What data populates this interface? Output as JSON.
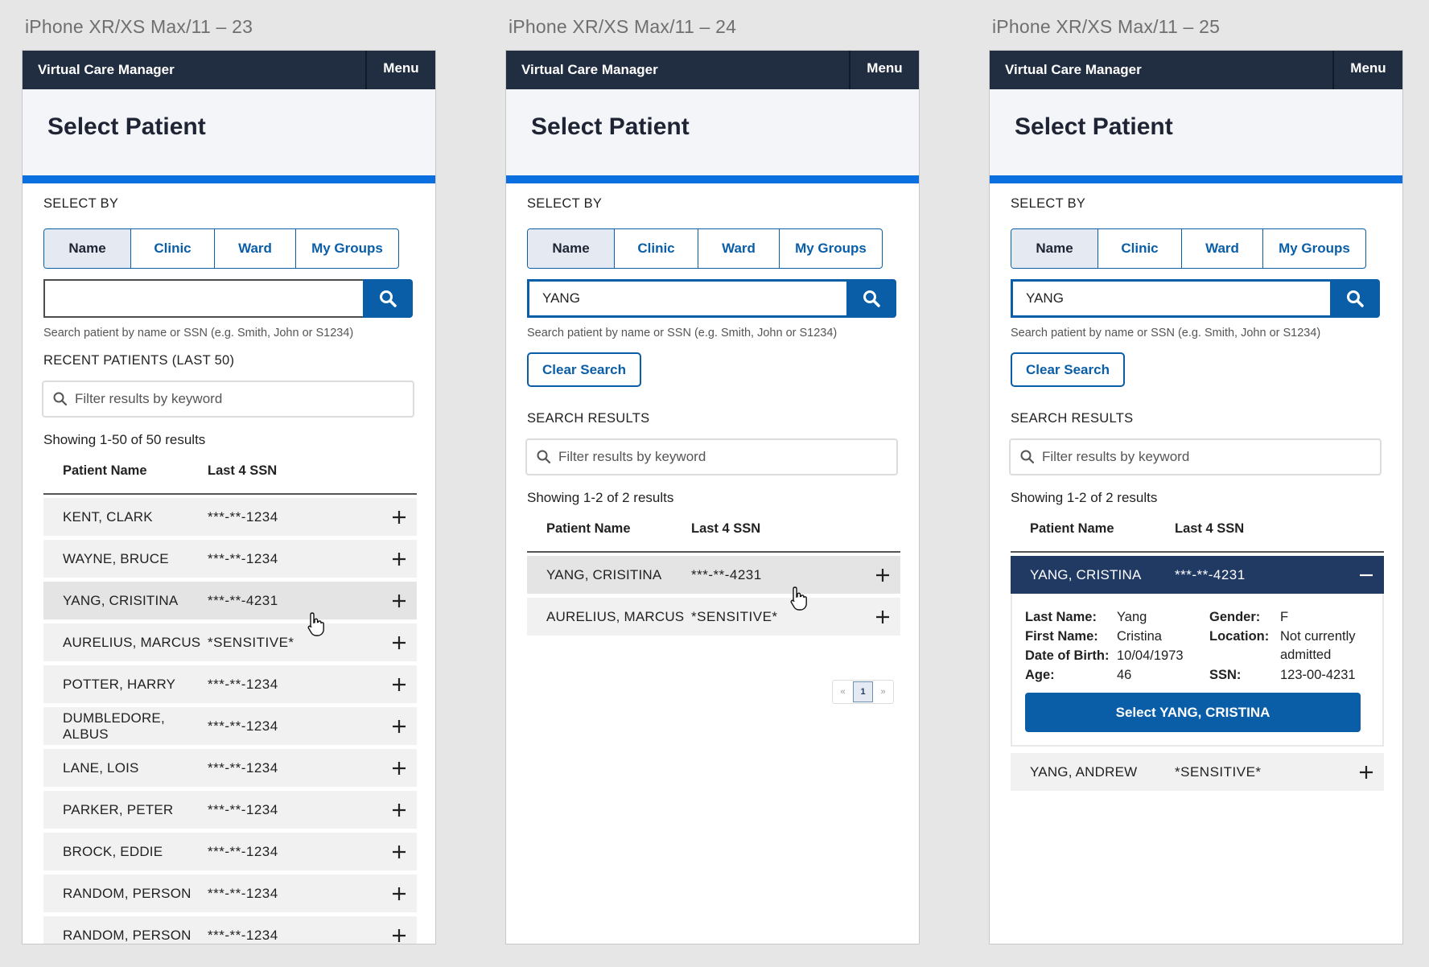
{
  "artboards": [
    {
      "label": "iPhone XR/XS Max/11 – 23"
    },
    {
      "label": "iPhone XR/XS Max/11 – 24"
    },
    {
      "label": "iPhone XR/XS Max/11 – 25"
    }
  ],
  "app": {
    "title": "Virtual Care Manager",
    "menu_label": "Menu"
  },
  "page": {
    "title": "Select Patient"
  },
  "select_by": {
    "label": "SELECT BY",
    "options": [
      "Name",
      "Clinic",
      "Ward",
      "My Groups"
    ],
    "selected": "Name"
  },
  "search": {
    "hint": "Search patient by name or SSN (e.g. Smith, John or S1234)",
    "value_empty": "",
    "value_yang": "YANG",
    "clear_label": "Clear Search"
  },
  "filter": {
    "placeholder": "Filter results by keyword"
  },
  "table": {
    "col_name": "Patient Name",
    "col_ssn": "Last 4 SSN"
  },
  "screen1": {
    "section_label": "RECENT PATIENTS (LAST 50)",
    "showing": "Showing 1-50 of 50 results",
    "rows": [
      {
        "name": "KENT, CLARK",
        "ssn": "***-**-1234"
      },
      {
        "name": "WAYNE, BRUCE",
        "ssn": "***-**-1234"
      },
      {
        "name": "YANG, CRISITINA",
        "ssn": "***-**-4231"
      },
      {
        "name": "AURELIUS, MARCUS",
        "ssn": "*SENSITIVE*"
      },
      {
        "name": "POTTER, HARRY",
        "ssn": "***-**-1234"
      },
      {
        "name": "DUMBLEDORE, ALBUS",
        "ssn": "***-**-1234"
      },
      {
        "name": "LANE, LOIS",
        "ssn": "***-**-1234"
      },
      {
        "name": "PARKER, PETER",
        "ssn": "***-**-1234"
      },
      {
        "name": "BROCK, EDDIE",
        "ssn": "***-**-1234"
      },
      {
        "name": "RANDOM, PERSON",
        "ssn": "***-**-1234"
      },
      {
        "name": "RANDOM, PERSON",
        "ssn": "***-**-1234"
      }
    ]
  },
  "screen2": {
    "section_label": "SEARCH RESULTS",
    "showing": "Showing 1-2 of 2 results",
    "rows": [
      {
        "name": "YANG, CRISITINA",
        "ssn": "***-**-4231"
      },
      {
        "name": "AURELIUS, MARCUS",
        "ssn": "*SENSITIVE*"
      }
    ],
    "pager": {
      "prev": "«",
      "current": "1",
      "next": "»"
    }
  },
  "screen3": {
    "section_label": "SEARCH RESULTS",
    "showing": "Showing 1-2 of 2 results",
    "expanded_row": {
      "name": "YANG, CRISTINA",
      "ssn": "***-**-4231"
    },
    "details": {
      "last_name_label": "Last Name:",
      "last_name": "Yang",
      "gender_label": "Gender:",
      "gender": "F",
      "first_name_label": "First Name:",
      "first_name": "Cristina",
      "location_label": "Location:",
      "location": "Not currently admitted",
      "dob_label": "Date of Birth:",
      "dob": "10/04/1973",
      "age_label": "Age:",
      "age": "46",
      "ssn_label": "SSN:",
      "ssn": "123-00-4231"
    },
    "select_button": "Select YANG, CRISTINA",
    "other_row": {
      "name": "YANG, ANDREW",
      "ssn": "*SENSITIVE*"
    }
  },
  "colors": {
    "nav": "#212d40",
    "accent": "#0b6fe0",
    "primary": "#0a5ea8",
    "expanded": "#213a64"
  }
}
